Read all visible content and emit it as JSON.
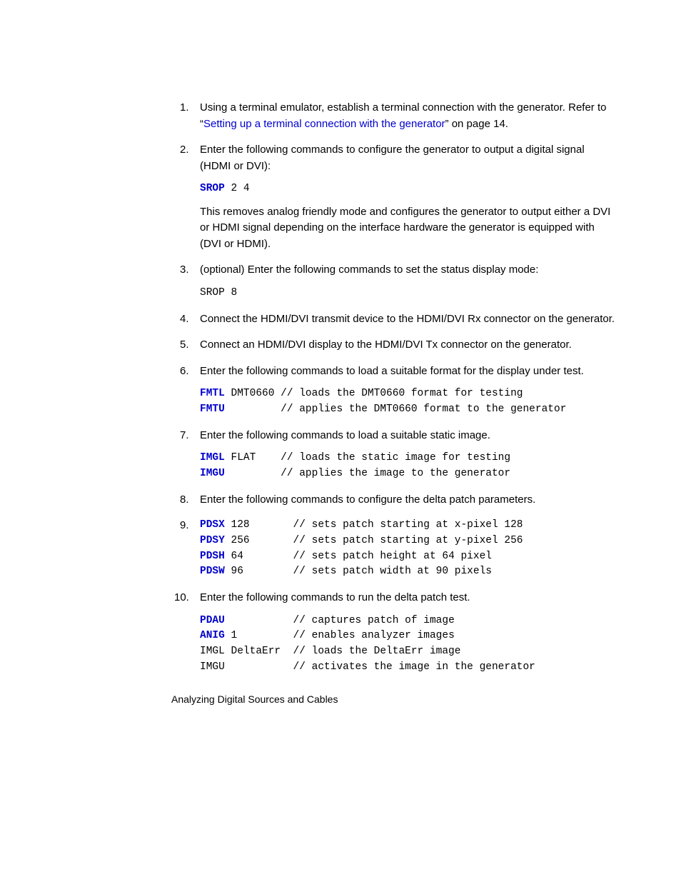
{
  "steps": {
    "s1": {
      "num": "1.",
      "pre": "Using a terminal emulator, establish a terminal connection with the generator. Refer to “",
      "link": "Setting up a terminal connection with the generator",
      "post": "” on page 14."
    },
    "s2": {
      "num": "2.",
      "text": "Enter the following commands to configure the generator to output a digital signal (HDMI or DVI):",
      "code_kw": "SROP",
      "code_rest": " 2 4",
      "after": "This removes analog friendly mode and configures the generator to output either a DVI or HDMI signal depending on the interface hardware the generator is equipped with (DVI or HDMI)."
    },
    "s3": {
      "num": "3.",
      "text": "(optional) Enter the following commands to set the status display mode:",
      "code_plain": "SROP 8"
    },
    "s4": {
      "num": "4.",
      "text": "Connect the HDMI/DVI transmit device to the HDMI/DVI Rx connector on the generator."
    },
    "s5": {
      "num": "5.",
      "text": "Connect an HDMI/DVI display to the HDMI/DVI Tx connector on the generator."
    },
    "s6": {
      "num": "6.",
      "text": "Enter the following commands to load a suitable format for the display under test.",
      "l1_kw": "FMTL",
      "l1_rest": " DMT0660 // loads the DMT0660 format for testing",
      "l2_kw": "FMTU",
      "l2_rest": "         // applies the DMT0660 format to the generator"
    },
    "s7": {
      "num": "7.",
      "text": "Enter the following commands to load a suitable static image.",
      "l1_kw": "IMGL",
      "l1_rest": " FLAT    // loads the static image for testing",
      "l2_kw": "IMGU",
      "l2_rest": "         // applies the image to the generator"
    },
    "s8": {
      "num": "8.",
      "text": "Enter the following commands to configure the delta patch parameters."
    },
    "s9": {
      "num": "9.",
      "l1_kw": "PDSX",
      "l1_rest": " 128       // sets patch starting at x-pixel 128",
      "l2_kw": "PDSY",
      "l2_rest": " 256       // sets patch starting at y-pixel 256",
      "l3_kw": "PDSH",
      "l3_rest": " 64        // sets patch height at 64 pixel",
      "l4_kw": "PDSW",
      "l4_rest": " 96        // sets patch width at 90 pixels"
    },
    "s10": {
      "num": "10.",
      "text": "Enter the following commands to run the delta patch test.",
      "l1_kw": "PDAU",
      "l1_rest": "           // captures patch of image",
      "l2_kw": "ANIG",
      "l2_rest": " 1         // enables analyzer images",
      "l3_plain": "IMGL DeltaErr  // loads the DeltaErr image",
      "l4_plain": "IMGU           // activates the image in the generator"
    }
  },
  "footer": "Analyzing Digital Sources and Cables"
}
